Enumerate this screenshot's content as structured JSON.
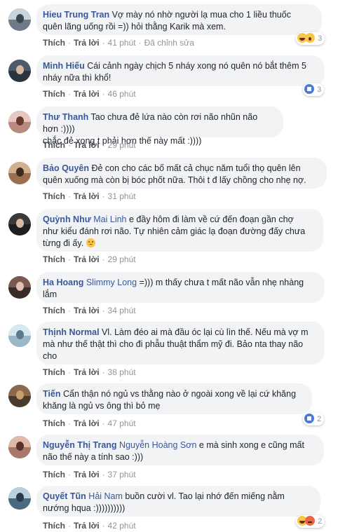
{
  "actions": {
    "like_label": "Thích",
    "reply_label": "Trả lời",
    "separator": "·",
    "edited_label": "Đã chỉnh sửa"
  },
  "colors": {
    "link_blue": "#385898",
    "bubble_bg": "#f2f3f5",
    "meta_gray": "#90949c"
  },
  "comments": [
    {
      "author": "Hieu Trung Tran",
      "tag": "",
      "lines": [
        "Vợ mày nó nhờ người lạ mua cho 1 liều thuốc",
        "quên lãng uống rồi =)) hỏi thằng Karik mà xem."
      ],
      "time": "41 phút",
      "edited": true,
      "reactions": {
        "icons": [
          "haha-icon",
          "wow-icon"
        ],
        "count": "3"
      }
    },
    {
      "author": "Minh Hiếu",
      "tag": "",
      "lines": [
        "Cái cảnh ngày chịch 5 nháy xong nó quên nó bắt thêm 5",
        "nháy nữa thì khổ!"
      ],
      "time": "46 phút",
      "edited": false,
      "reactions": {
        "icons": [
          "like-icon"
        ],
        "count": "3"
      }
    },
    {
      "author": "Thư Thanh",
      "tag": "",
      "lines": [
        "Tao chưa đẻ lứa nào còn rơi não nhũn não hơn :))))",
        "chắc đẻ xong t phải hơn thế này mất :))))"
      ],
      "time": "29 phút",
      "edited": false,
      "reactions": null
    },
    {
      "author": "Bảo Quyên",
      "tag": "",
      "lines": [
        "Đẻ con cho các bố mất cả chục năm tuổi thọ quên lên",
        "quên xuống mà còn bị bóc phốt nữa. Thôi t đ lấy chồng cho nhẹ nợ."
      ],
      "time": "31 phút",
      "edited": false,
      "reactions": null
    },
    {
      "author": "Quỳnh Như",
      "tag": "Mai Linh",
      "lines": [
        "e đầy hôm đi làm về cứ đến đoạn gần chợ",
        "như kiểu đánh rơi não. Tự nhiên cảm giác lạ đoạn đường đấy chưa",
        "từng đi ấy."
      ],
      "time": "29 phút",
      "edited": false,
      "reactions": null
    },
    {
      "author": "Ha Hoang",
      "tag": "Slimmy Long",
      "lines": [
        "=))) m thấy chưa t mất não vẫn nhẹ nhàng",
        "lắm"
      ],
      "time": "34 phút",
      "edited": false,
      "reactions": null
    },
    {
      "author": "Thịnh Normal",
      "tag": "",
      "lines": [
        "Vl. Làm đéo ai mà đầu óc lại cù lìn thế. Nếu mà vợ m",
        "mà như thế thật thì cho đi phẫu thuật thẩm mỹ đi. Bảo nta thay não",
        "cho"
      ],
      "time": "38 phút",
      "edited": false,
      "reactions": null
    },
    {
      "author": "Tiến",
      "tag": "",
      "lines": [
        "Cẩn thận nó ngủ vs thằng nào ở ngoài xong về lại cứ khăng",
        "khăng là ngủ vs ông thì bỏ mẹ"
      ],
      "time": "47 phút",
      "edited": false,
      "reactions": {
        "icons": [
          "like-icon"
        ],
        "count": "2"
      }
    },
    {
      "author": "Nguyễn Thị Trang",
      "tag": "Nguyễn Hoàng Sơn",
      "lines": [
        "e mà sinh xong e cũng mất",
        "não thế này a tính sao :)))"
      ],
      "time": "37 phút",
      "edited": false,
      "reactions": null
    },
    {
      "author": "Quyết Tũn",
      "tag": "Hải Nam",
      "lines": [
        "buồn cười vl. Tao lại nhớ đến miếng nằm",
        "nướng hqua :))))))))))"
      ],
      "time": "42 phút",
      "edited": false,
      "reactions": {
        "icons": [
          "haha-icon",
          "angry-icon"
        ],
        "count": "2"
      }
    }
  ]
}
